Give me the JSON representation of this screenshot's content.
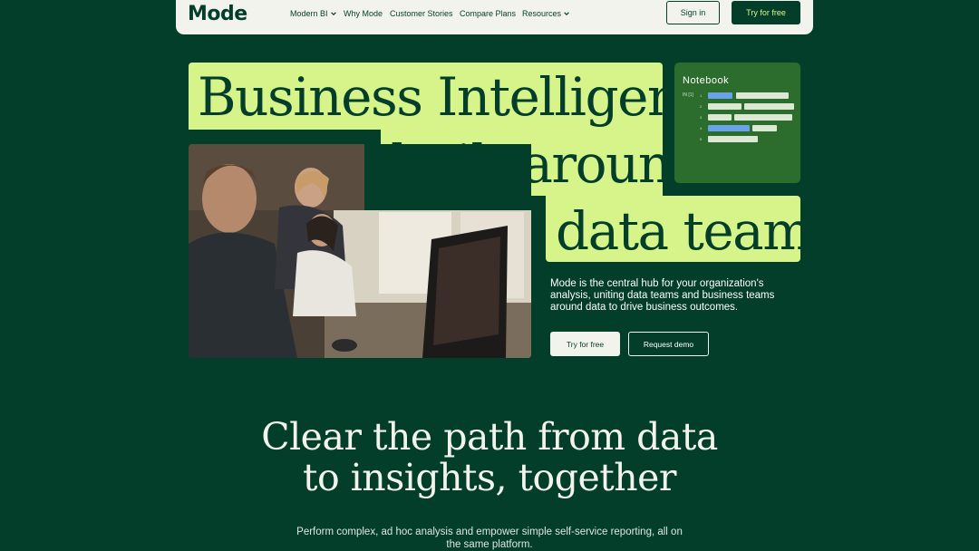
{
  "nav": {
    "logo": "Mode",
    "items": [
      {
        "label": "Modern BI",
        "has_dropdown": true
      },
      {
        "label": "Why Mode",
        "has_dropdown": false
      },
      {
        "label": "Customer Stories",
        "has_dropdown": false
      },
      {
        "label": "Compare Plans",
        "has_dropdown": false
      },
      {
        "label": "Resources",
        "has_dropdown": true
      }
    ],
    "sign_in": "Sign in",
    "try_free": "Try for free"
  },
  "hero": {
    "line1": "Business Intelligence",
    "line2": "built around",
    "line3": "data teams",
    "description": "Mode is the central hub for your organization's analysis, uniting data teams and business teams around data to drive business outcomes.",
    "cta_primary": "Try for free",
    "cta_secondary": "Request demo"
  },
  "notebook": {
    "title": "Notebook",
    "cell_label": "IN [1]",
    "line_numbers": [
      "1",
      "2",
      "3",
      "4",
      "5"
    ]
  },
  "section": {
    "title_line1": "Clear the path from data",
    "title_line2": "to insights, together",
    "subtitle": "Perform complex, ad hoc analysis and empower simple self-service reporting, all on the same platform."
  },
  "colors": {
    "background": "#023e29",
    "lime": "#d7f48b",
    "notebook_bg": "#2c6c2c",
    "code_blue": "#6aa2e8",
    "code_light": "#dbe8d3"
  }
}
